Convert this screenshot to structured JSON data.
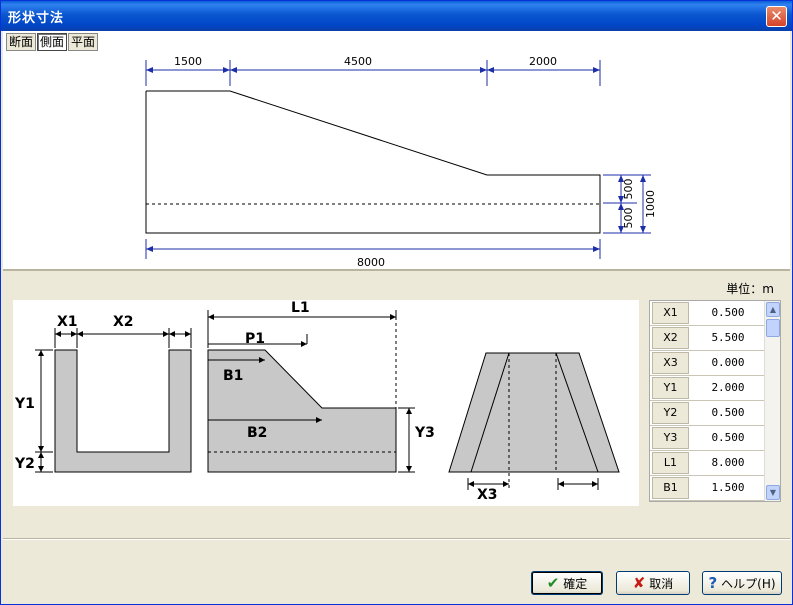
{
  "window": {
    "title": "形状寸法",
    "close_symbol": "✕"
  },
  "tabs": [
    {
      "label": "断面"
    },
    {
      "label": "側面",
      "selected": true
    },
    {
      "label": "平面"
    }
  ],
  "side_drawing": {
    "dims_top": [
      "1500",
      "4500",
      "2000"
    ],
    "dim_bottom": "8000",
    "dims_right": [
      "500",
      "500",
      "1000"
    ]
  },
  "unit_label": "単位：m",
  "schematic_labels": {
    "x1": "X1",
    "x2": "X2",
    "y1": "Y1",
    "y2": "Y2",
    "l1": "L1",
    "p1": "P1",
    "b1": "B1",
    "b2": "B2",
    "y3": "Y3",
    "x3": "X3"
  },
  "params": [
    {
      "name": "X1",
      "value": "0.500"
    },
    {
      "name": "X2",
      "value": "5.500"
    },
    {
      "name": "X3",
      "value": "0.000"
    },
    {
      "name": "Y1",
      "value": "2.000"
    },
    {
      "name": "Y2",
      "value": "0.500"
    },
    {
      "name": "Y3",
      "value": "0.500"
    },
    {
      "name": "L1",
      "value": "8.000"
    },
    {
      "name": "B1",
      "value": "1.500"
    }
  ],
  "buttons": {
    "ok": "確定",
    "cancel": "取消",
    "help": "ヘルプ(H)"
  },
  "colors": {
    "dimension_blue": "#1c2fa8",
    "shape_gray": "#c8c8c8",
    "titlebar": "#0b57d0"
  }
}
